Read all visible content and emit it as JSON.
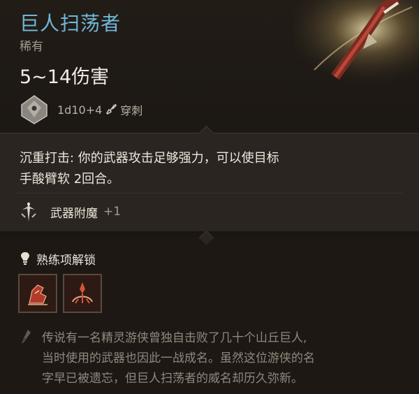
{
  "item": {
    "name": "巨人扫荡者",
    "rarity": "稀有",
    "damage": "5~14伤害",
    "dice": "1d10+4",
    "damage_type": "穿刺"
  },
  "ability": {
    "description_line1": "沉重打击: 你的武器攻击足够强力，可以使目标",
    "description_line2": "手酸臂软 2回合。"
  },
  "enchantment": {
    "label": "武器附魔",
    "value": "+1"
  },
  "proficiency": {
    "label": "熟练项解锁",
    "skills": [
      "skill-1",
      "skill-2"
    ]
  },
  "lore": {
    "line1": "传说有一名精灵游侠曾独自击败了几十个山丘巨人,",
    "line2": "当时使用的武器也因此一战成名。虽然这位游侠的名",
    "line3": "字早已被遗忘，但巨人扫荡者的威名却历久弥新。"
  },
  "colors": {
    "title": "#6fb7d9",
    "accent_red": "#c8422f",
    "text": "#ece6dc",
    "muted": "#8f887d"
  }
}
